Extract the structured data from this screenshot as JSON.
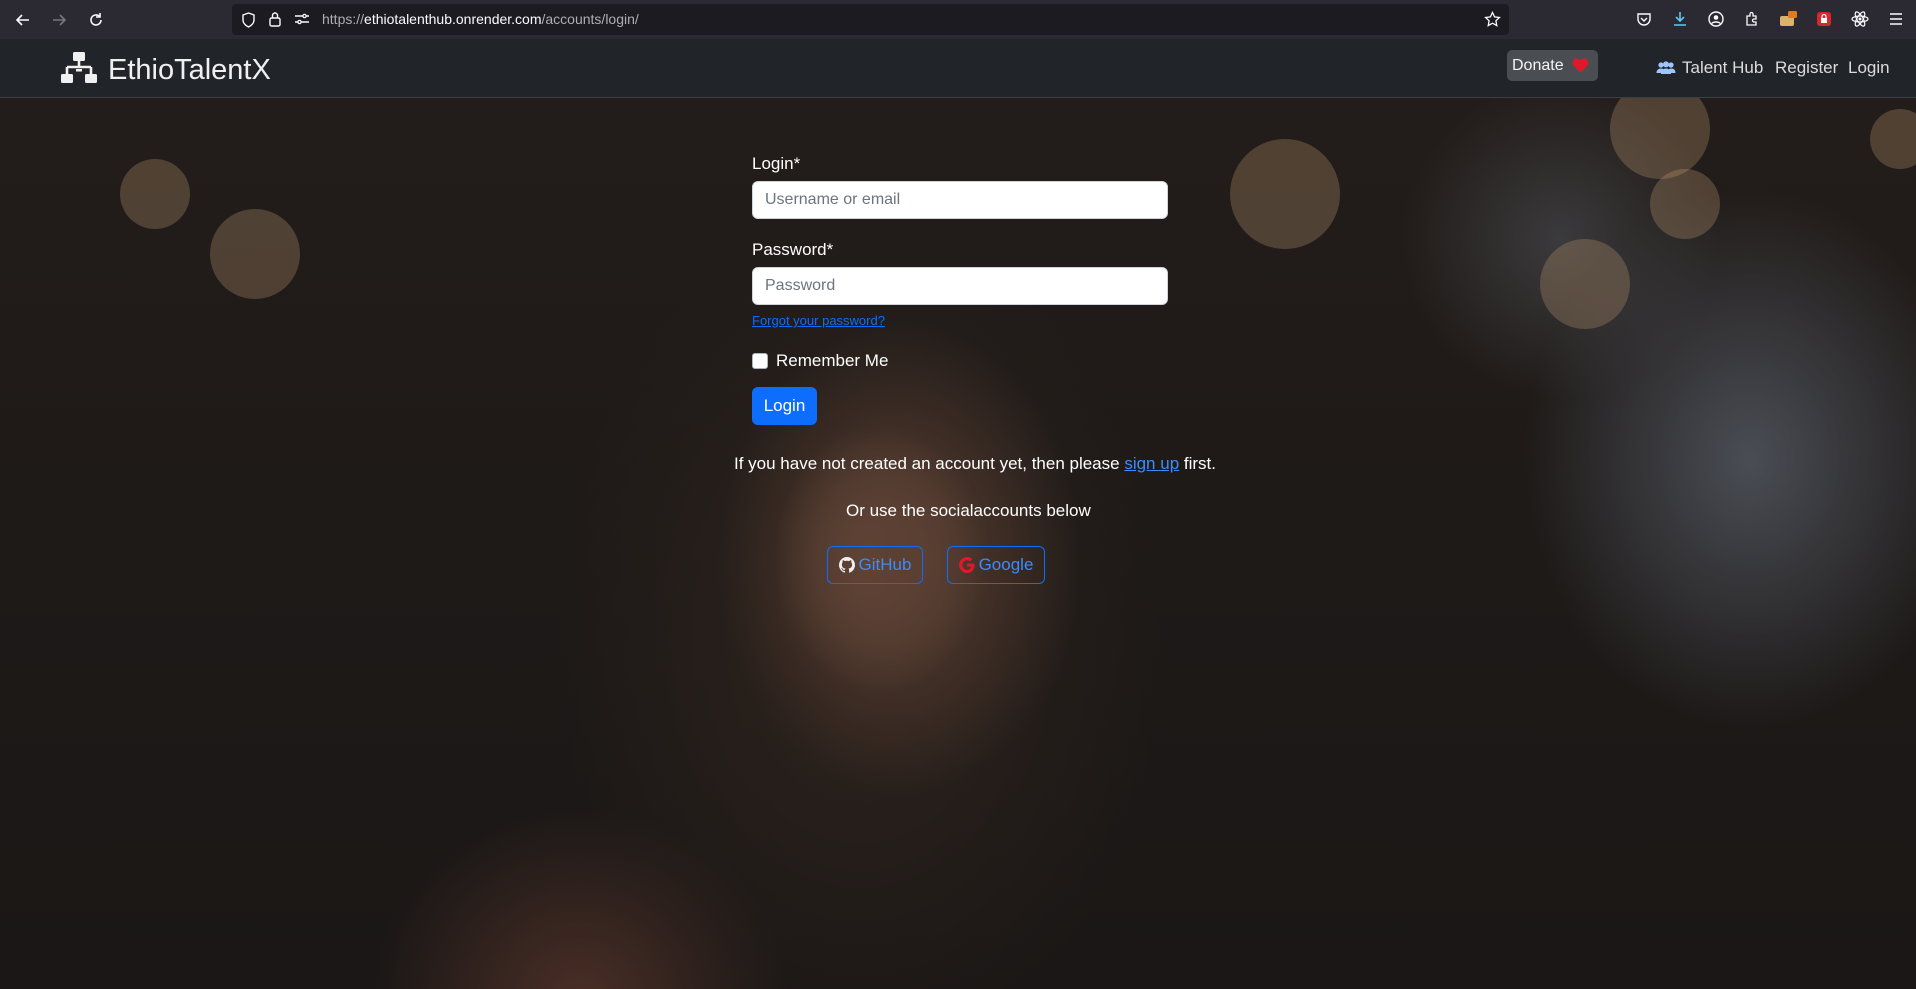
{
  "browser": {
    "url_prefix": "https://",
    "url_host": "ethiotalenthub.onrender.com",
    "url_path": "/accounts/login/"
  },
  "navbar": {
    "brand": "EthioTalentX",
    "donate_label": "Donate",
    "talent_hub_label": "Talent Hub",
    "register_label": "Register",
    "login_label": "Login"
  },
  "form": {
    "login_label": "Login*",
    "login_placeholder": "Username or email",
    "password_label": "Password*",
    "password_placeholder": "Password",
    "forgot_label": "Forgot your password?",
    "remember_label": "Remember Me",
    "submit_label": "Login",
    "signup_prefix": "If you have not created an account yet, then please ",
    "signup_link": "sign up",
    "signup_suffix": " first.",
    "social_text": "Or use the socialaccounts below",
    "github_label": "GitHub",
    "google_label": "Google"
  },
  "colors": {
    "primary": "#0d6efd",
    "navbar_bg": "#212529",
    "heart": "#e0182d"
  }
}
